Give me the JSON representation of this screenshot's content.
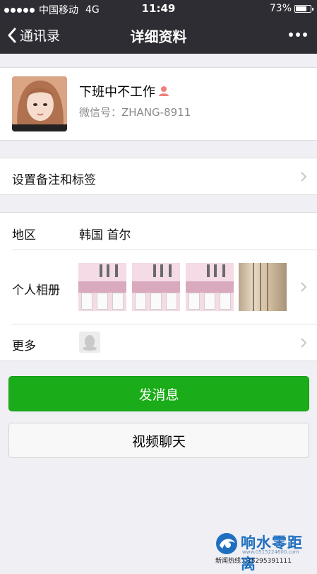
{
  "status_bar": {
    "carrier": "中国移动",
    "network": "4G",
    "time": "11:49",
    "battery_text": "73%",
    "battery_level": 0.73
  },
  "navbar": {
    "back_label": "通讯录",
    "title": "详细资料"
  },
  "profile": {
    "nickname": "下班中不工作",
    "wechat_id": "微信号：ZHANG-8911",
    "gender_icon_color": "#f0807a"
  },
  "rows": {
    "remark_label": "设置备注和标签",
    "region_label": "地区",
    "region_value": "韩国 首尔",
    "album_label": "个人相册",
    "more_label": "更多"
  },
  "buttons": {
    "send_message": "发消息",
    "video_call": "视频聊天"
  },
  "watermark": {
    "title": "响水零距离",
    "url": "www.0515224600.com",
    "hotline": "新闻热线：15295391111"
  },
  "colors": {
    "navbar_bg": "#2e2d33",
    "primary_green": "#1aad19",
    "page_bg": "#efeff4"
  }
}
